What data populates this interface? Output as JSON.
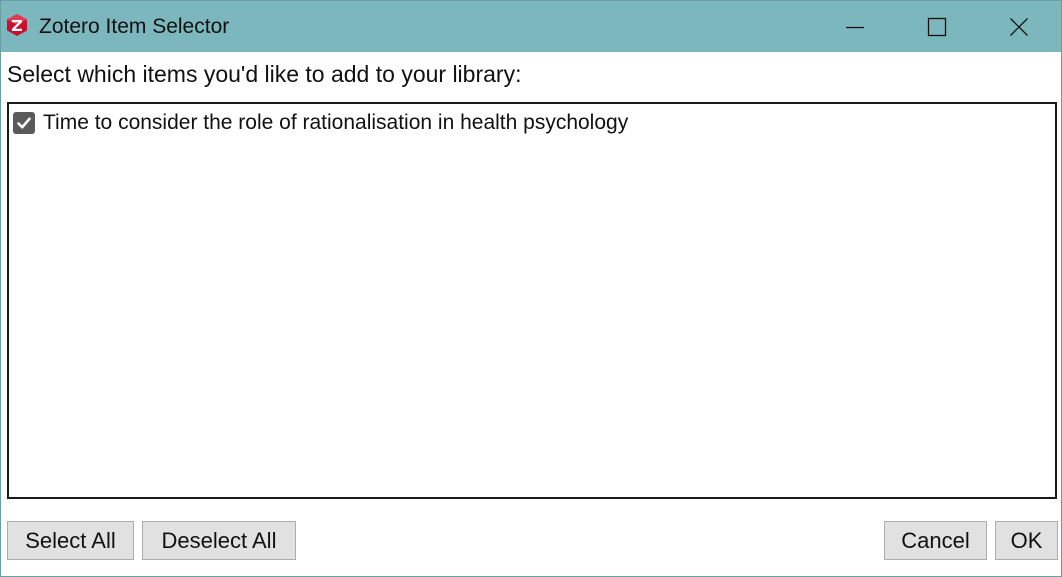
{
  "window": {
    "title": "Zotero Item Selector",
    "app_icon": "zotero-z-icon",
    "controls": {
      "minimize_icon": "minimize-icon",
      "maximize_icon": "maximize-icon",
      "close_icon": "close-icon"
    }
  },
  "prompt": "Select which items you'd like to add to your library:",
  "items": [
    {
      "label": "Time to consider the role of rationalisation in health psychology",
      "checked": true
    }
  ],
  "buttons": {
    "select_all": "Select All",
    "deselect_all": "Deselect All",
    "cancel": "Cancel",
    "ok": "OK"
  },
  "colors": {
    "titlebar": "#7db7be",
    "icon_red": "#c8102e",
    "checkbox": "#5a5a5a",
    "button_bg": "#e1e1e1"
  }
}
